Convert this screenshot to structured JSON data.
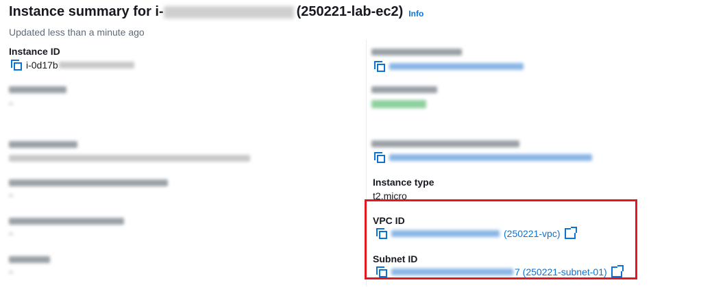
{
  "header": {
    "title_prefix": "Instance summary for i-",
    "title_suffix": "(250221-lab-ec2)",
    "info_link": "Info",
    "updated": "Updated less than a minute ago"
  },
  "instance_id": {
    "label": "Instance ID",
    "value_prefix": "i-0d17b"
  },
  "instance_type": {
    "label": "Instance type",
    "value": "t2.micro"
  },
  "vpc": {
    "label": "VPC ID",
    "value_suffix": "(250221-vpc)"
  },
  "subnet": {
    "label": "Subnet ID",
    "value_suffix": "7 (250221-subnet-01)"
  },
  "colors": {
    "link": "#0972d3",
    "highlight": "#e3171f"
  }
}
